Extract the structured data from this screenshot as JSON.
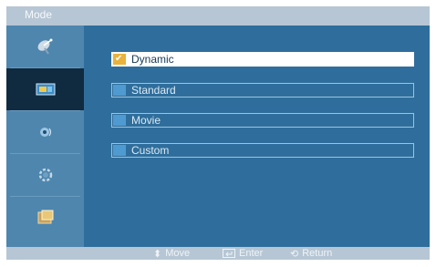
{
  "window": {
    "title": "Mode"
  },
  "sidebar": {
    "items": [
      {
        "icon": "satellite-dish-icon",
        "active": false
      },
      {
        "icon": "picture-icon",
        "active": true
      },
      {
        "icon": "sound-icon",
        "active": false
      },
      {
        "icon": "setup-gear-icon",
        "active": false
      },
      {
        "icon": "input-icon",
        "active": false
      }
    ]
  },
  "menu": {
    "options": [
      {
        "label": "Dynamic",
        "selected": true
      },
      {
        "label": "Standard",
        "selected": false
      },
      {
        "label": "Movie",
        "selected": false
      },
      {
        "label": "Custom",
        "selected": false
      }
    ]
  },
  "footer": {
    "move_label": "Move",
    "enter_label": "Enter",
    "return_label": "Return"
  },
  "colors": {
    "panel": "#2f6e9c",
    "sidebar": "#4e86ae",
    "active_sidebar": "#102a40",
    "title_footer": "#b7c6d4",
    "selected_mark": "#e9b33b",
    "option_mark": "#4f9ad0"
  }
}
